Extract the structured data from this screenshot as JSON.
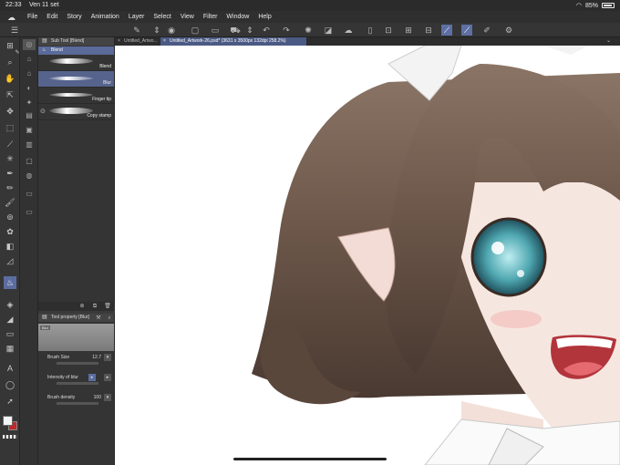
{
  "status": {
    "time": "22:33",
    "date": "Ven 11 set",
    "battery": "85%"
  },
  "menu": {
    "items": [
      "File",
      "Edit",
      "Story",
      "Animation",
      "Layer",
      "Select",
      "View",
      "Filter",
      "Window",
      "Help"
    ]
  },
  "tabs": {
    "items": [
      {
        "label": "Untitled_Artwo..."
      },
      {
        "label": "Untitled_Artwork-26.psd* (3631 x 3500px 132dpi 258.2%)"
      }
    ]
  },
  "subtool_panel": {
    "title": "Sub Tool [Blend]",
    "group": "Blend",
    "brushes": [
      {
        "label": "Blend"
      },
      {
        "label": "Blur"
      },
      {
        "label": "Finger tip"
      },
      {
        "label": "Copy stamp"
      }
    ]
  },
  "tool_property": {
    "title": "Tool property [Blur]",
    "preview_tag": "Blur",
    "brush_size_label": "Brush Size",
    "brush_size_value": "12.7",
    "intensity_label": "Intensity of blur",
    "density_label": "Brush density",
    "density_value": "100"
  },
  "colors": {
    "accent": "#5b6da0",
    "main_color": "#f4f4f4",
    "sub_color": "#c0282a",
    "hair": "#6b5649",
    "eye": "#4fa7b0"
  },
  "icons": {
    "active_tool": "blend-tool-icon"
  }
}
